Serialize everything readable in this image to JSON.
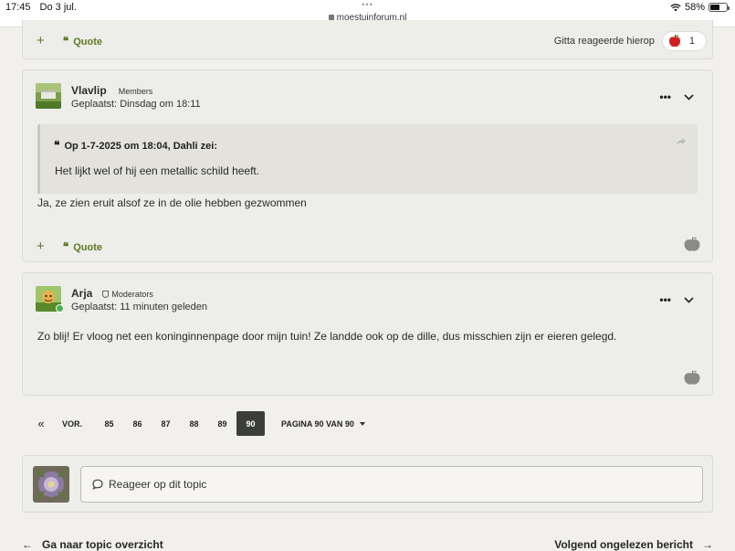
{
  "status_bar": {
    "time": "17:45",
    "date": "Do 3 jul.",
    "dots": "•••",
    "url": "moestuinforum.nl",
    "battery": "58%"
  },
  "top_post_footer": {
    "plus": "+",
    "quote_label": "Quote",
    "reaction_text": "Gitta reageerde hierop",
    "reaction_count": "1"
  },
  "posts": [
    {
      "author": "Vlavlip",
      "group": "Members",
      "posted": "Geplaatst: Dinsdag om 18:11",
      "quote_header": "Op 1-7-2025 om 18:04, Dahli zei:",
      "quote_text": "Het lijkt wel of hij een metallic schild heeft.",
      "text": "Ja, ze zien eruit alsof ze in de olie hebben gezwommen",
      "plus": "+",
      "quote_label": "Quote"
    },
    {
      "author": "Arja",
      "group": "Moderators",
      "posted": "Geplaatst: 11 minuten geleden",
      "text": "Zo blij! Er vloog net een koninginnenpage door mijn tuin! Ze landde ook op de dille, dus misschien zijn er eieren gelegd."
    }
  ],
  "post_controls": {
    "more": "•••"
  },
  "pagination": {
    "first": "«",
    "prev": "VOR.",
    "pages": [
      "85",
      "86",
      "87",
      "88",
      "89"
    ],
    "current": "90",
    "jump": "PAGINA 90 VAN 90"
  },
  "reply": {
    "placeholder": "Reageer op dit topic"
  },
  "bottom_nav": {
    "back": "Ga naar topic overzicht",
    "next": "Volgend ongelezen bericht",
    "back_arrow": "←",
    "next_arrow": "→"
  },
  "colors": {
    "accent_green": "#5c7a24",
    "current_page_bg": "#3c3e39",
    "online": "#4caf50"
  },
  "icons": [
    "wifi-icon",
    "battery-icon",
    "lock-icon",
    "quote-icon",
    "apple-reaction-icon",
    "share-icon",
    "chevron-down-icon",
    "moderator-shield-icon",
    "speech-bubble-icon"
  ]
}
